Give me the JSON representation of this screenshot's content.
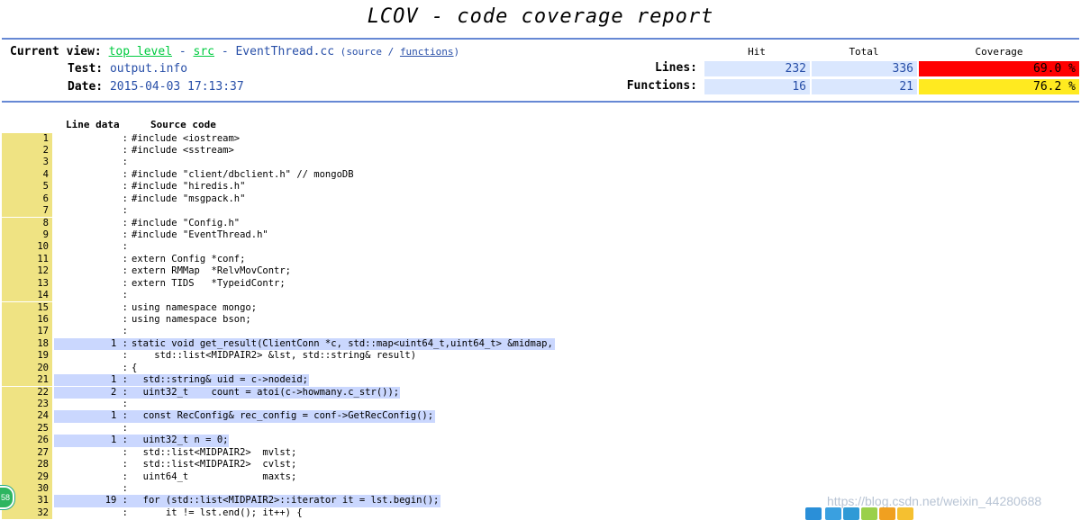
{
  "header": {
    "title": "LCOV - code coverage report",
    "current_view_label": "Current view:",
    "crumb_top": "top level",
    "crumb_dash1": " - ",
    "crumb_src": "src",
    "crumb_dash2": " - ",
    "crumb_file": "EventThread.cc",
    "open_paren": " (",
    "view_source": "source",
    "slash": " / ",
    "view_functions": "functions",
    "close_paren": ")",
    "test_label": "Test:",
    "test_value": "output.info",
    "date_label": "Date:",
    "date_value": "2015-04-03 17:13:37"
  },
  "stats": {
    "col_hit": "Hit",
    "col_total": "Total",
    "col_coverage": "Coverage",
    "lines_label": "Lines:",
    "lines_hit": "232",
    "lines_total": "336",
    "lines_cov": "69.0 %",
    "functions_label": "Functions:",
    "functions_hit": "16",
    "functions_total": "21",
    "functions_cov": "76.2 %",
    "colors": {
      "low": "#ff0000",
      "medium": "#ffea20",
      "num_bg": "#dae7fe",
      "rule": "#6688d4",
      "line_no_bg": "#efe383",
      "covered_bg": "#cad7fe"
    }
  },
  "source": {
    "col_line_data": "Line data",
    "col_source_code": "Source code",
    "lines": [
      {
        "n": "1",
        "hit": "",
        "code": "#include <iostream>",
        "covered": false
      },
      {
        "n": "2",
        "hit": "",
        "code": "#include <sstream>",
        "covered": false
      },
      {
        "n": "3",
        "hit": "",
        "code": "",
        "covered": false
      },
      {
        "n": "4",
        "hit": "",
        "code": "#include \"client/dbclient.h\" // mongoDB",
        "covered": false
      },
      {
        "n": "5",
        "hit": "",
        "code": "#include \"hiredis.h\"",
        "covered": false
      },
      {
        "n": "6",
        "hit": "",
        "code": "#include \"msgpack.h\"",
        "covered": false
      },
      {
        "n": "7",
        "hit": "",
        "code": "",
        "covered": false
      },
      {
        "n": "8",
        "hit": "",
        "code": "#include \"Config.h\"",
        "covered": false
      },
      {
        "n": "9",
        "hit": "",
        "code": "#include \"EventThread.h\"",
        "covered": false
      },
      {
        "n": "10",
        "hit": "",
        "code": "",
        "covered": false
      },
      {
        "n": "11",
        "hit": "",
        "code": "extern Config *conf;",
        "covered": false
      },
      {
        "n": "12",
        "hit": "",
        "code": "extern RMMap  *RelvMovContr;",
        "covered": false
      },
      {
        "n": "13",
        "hit": "",
        "code": "extern TIDS   *TypeidContr;",
        "covered": false
      },
      {
        "n": "14",
        "hit": "",
        "code": "",
        "covered": false
      },
      {
        "n": "15",
        "hit": "",
        "code": "using namespace mongo;",
        "covered": false
      },
      {
        "n": "16",
        "hit": "",
        "code": "using namespace bson;",
        "covered": false
      },
      {
        "n": "17",
        "hit": "",
        "code": "",
        "covered": false
      },
      {
        "n": "18",
        "hit": "1",
        "code": "static void get_result(ClientConn *c, std::map<uint64_t,uint64_t> &midmap,",
        "covered": true
      },
      {
        "n": "19",
        "hit": "",
        "code": "    std::list<MIDPAIR2> &lst, std::string& result)",
        "covered": false
      },
      {
        "n": "20",
        "hit": "",
        "code": "{",
        "covered": false
      },
      {
        "n": "21",
        "hit": "1",
        "code": "  std::string& uid = c->nodeid;",
        "covered": true
      },
      {
        "n": "22",
        "hit": "2",
        "code": "  uint32_t    count = atoi(c->howmany.c_str());",
        "covered": true
      },
      {
        "n": "23",
        "hit": "",
        "code": "",
        "covered": false
      },
      {
        "n": "24",
        "hit": "1",
        "code": "  const RecConfig& rec_config = conf->GetRecConfig();",
        "covered": true
      },
      {
        "n": "25",
        "hit": "",
        "code": "",
        "covered": false
      },
      {
        "n": "26",
        "hit": "1",
        "code": "  uint32_t n = 0;",
        "covered": true
      },
      {
        "n": "27",
        "hit": "",
        "code": "  std::list<MIDPAIR2>  mvlst;",
        "covered": false
      },
      {
        "n": "28",
        "hit": "",
        "code": "  std::list<MIDPAIR2>  cvlst;",
        "covered": false
      },
      {
        "n": "29",
        "hit": "",
        "code": "  uint64_t             maxts;",
        "covered": false
      },
      {
        "n": "30",
        "hit": "",
        "code": "",
        "covered": false
      },
      {
        "n": "31",
        "hit": "19",
        "code": "  for (std::list<MIDPAIR2>::iterator it = lst.begin();",
        "covered": true
      },
      {
        "n": "32",
        "hit": "",
        "code": "      it != lst.end(); it++) {",
        "covered": false
      }
    ]
  },
  "watermark": "https://blog.csdn.net/weixin_44280688",
  "badge_text": "58"
}
